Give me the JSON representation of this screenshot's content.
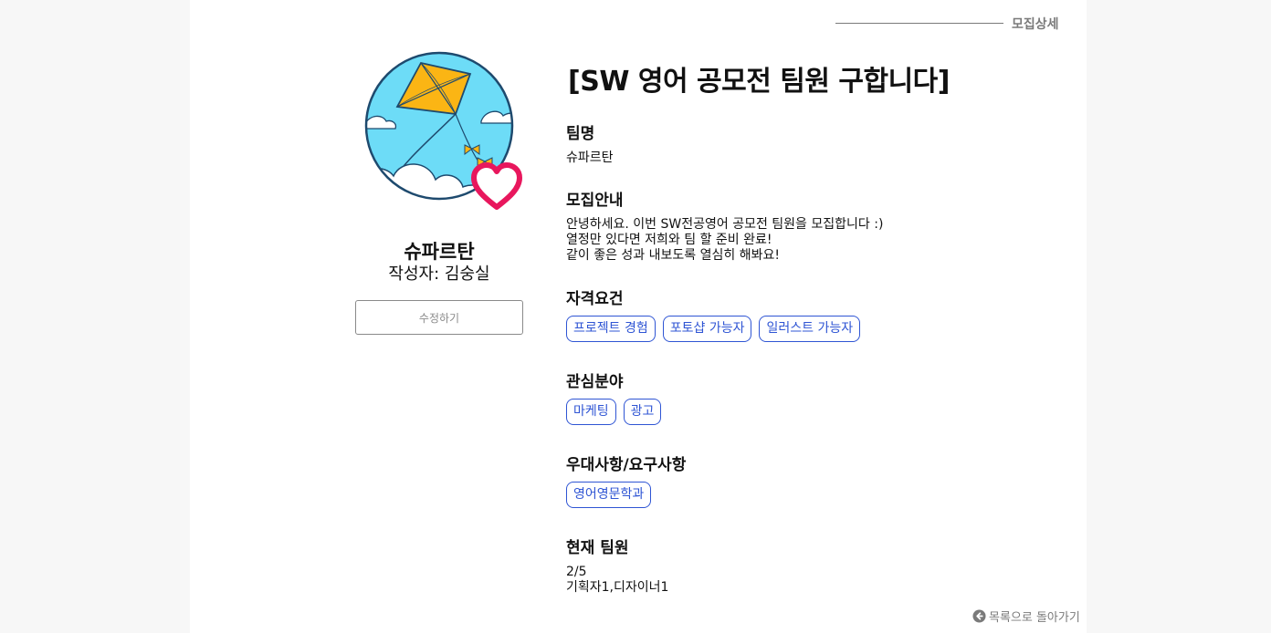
{
  "header": {
    "label": "모집상세"
  },
  "profile": {
    "team_name": "슈파르탄",
    "author_line": "작성자: 김숭실",
    "avatar_icon": "kite-icon",
    "like_icon": "heart-icon",
    "edit_label": "수정하기"
  },
  "post": {
    "title": "[SW 영어 공모전 팀원 구합니다]",
    "team": {
      "heading": "팀명",
      "value": "슈파르탄"
    },
    "guide": {
      "heading": "모집안내",
      "lines": [
        "안녕하세요. 이번 SW전공영어 공모전 팀원을 모집합니다 :)",
        "열정만 있다면 저희와 팀 할 준비 완료!",
        "같이 좋은 성과 내보도록 열심히 해봐요!"
      ]
    },
    "qualifications": {
      "heading": "자격요건",
      "tags": [
        "프로젝트 경험",
        "포토샵 가능자",
        "일러스트 가능자"
      ]
    },
    "interests": {
      "heading": "관심분야",
      "tags": [
        "마케팅",
        "광고"
      ]
    },
    "preferences": {
      "heading": "우대사항/요구사항",
      "tags": [
        "영어영문학과"
      ]
    },
    "members": {
      "heading": "현재 팀원",
      "count": "2/5",
      "roles": "기획자1,디자이너1"
    }
  },
  "footer": {
    "back_label": "목록으로 돌아가기",
    "back_icon": "arrow-left-circle-icon"
  },
  "colors": {
    "tag_blue": "#2f55d4",
    "heart_pink": "#e8175d",
    "sky_blue": "#6ddcf7",
    "kite_yellow": "#fbb514",
    "muted_gray": "#7a7a7a"
  }
}
